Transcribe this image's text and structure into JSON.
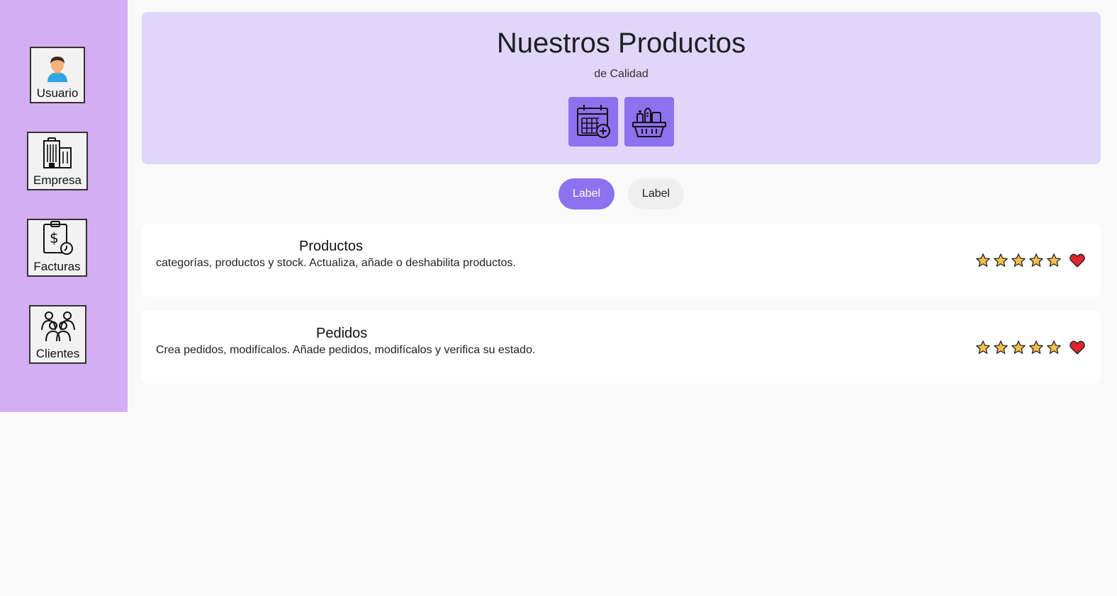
{
  "sidebar": {
    "items": [
      {
        "label": "Usuario",
        "icon": "user-icon"
      },
      {
        "label": "Empresa",
        "icon": "building-icon"
      },
      {
        "label": "Facturas",
        "icon": "invoice-icon"
      },
      {
        "label": "Clientes",
        "icon": "group-icon"
      }
    ]
  },
  "hero": {
    "title": "Nuestros Productos",
    "subtitle": "de Calidad",
    "buttons": [
      {
        "icon": "calendar-add-icon"
      },
      {
        "icon": "grocery-basket-icon"
      }
    ]
  },
  "chips": [
    {
      "label": "Label",
      "active": true
    },
    {
      "label": "Label",
      "active": false
    }
  ],
  "cards": [
    {
      "title": "Productos",
      "description": "categorías, productos y stock. Actualiza, añade o deshabilita productos.",
      "rating": 5,
      "favorite": true
    },
    {
      "title": "Pedidos",
      "description": "Crea pedidos, modifícalos. Añade pedidos, modifícalos y verifica su estado.",
      "rating": 5,
      "favorite": true
    }
  ],
  "colors": {
    "sidebar_bg": "#d3aef3",
    "hero_bg": "#dfd7fa",
    "accent": "#8b72ee",
    "star": "#f7c04a",
    "heart": "#e3242b"
  }
}
